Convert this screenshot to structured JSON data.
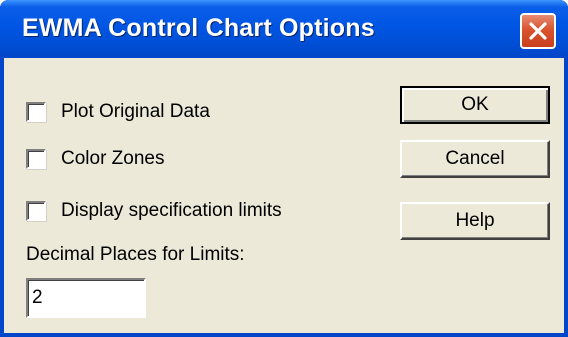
{
  "window": {
    "title": "EWMA Control Chart Options"
  },
  "icons": {
    "close": "close-icon"
  },
  "options": [
    {
      "label": "Plot Original Data",
      "checked": false
    },
    {
      "label": "Color Zones",
      "checked": false
    },
    {
      "label": "Display specification limits",
      "checked": false
    }
  ],
  "decimal_places": {
    "label": "Decimal Places for Limits:",
    "value": "2"
  },
  "buttons": {
    "ok": "OK",
    "cancel": "Cancel",
    "help": "Help"
  },
  "colors": {
    "titlebar": "#0055e3",
    "dialog_face": "#ece9d8",
    "close_button": "#d9542f"
  }
}
